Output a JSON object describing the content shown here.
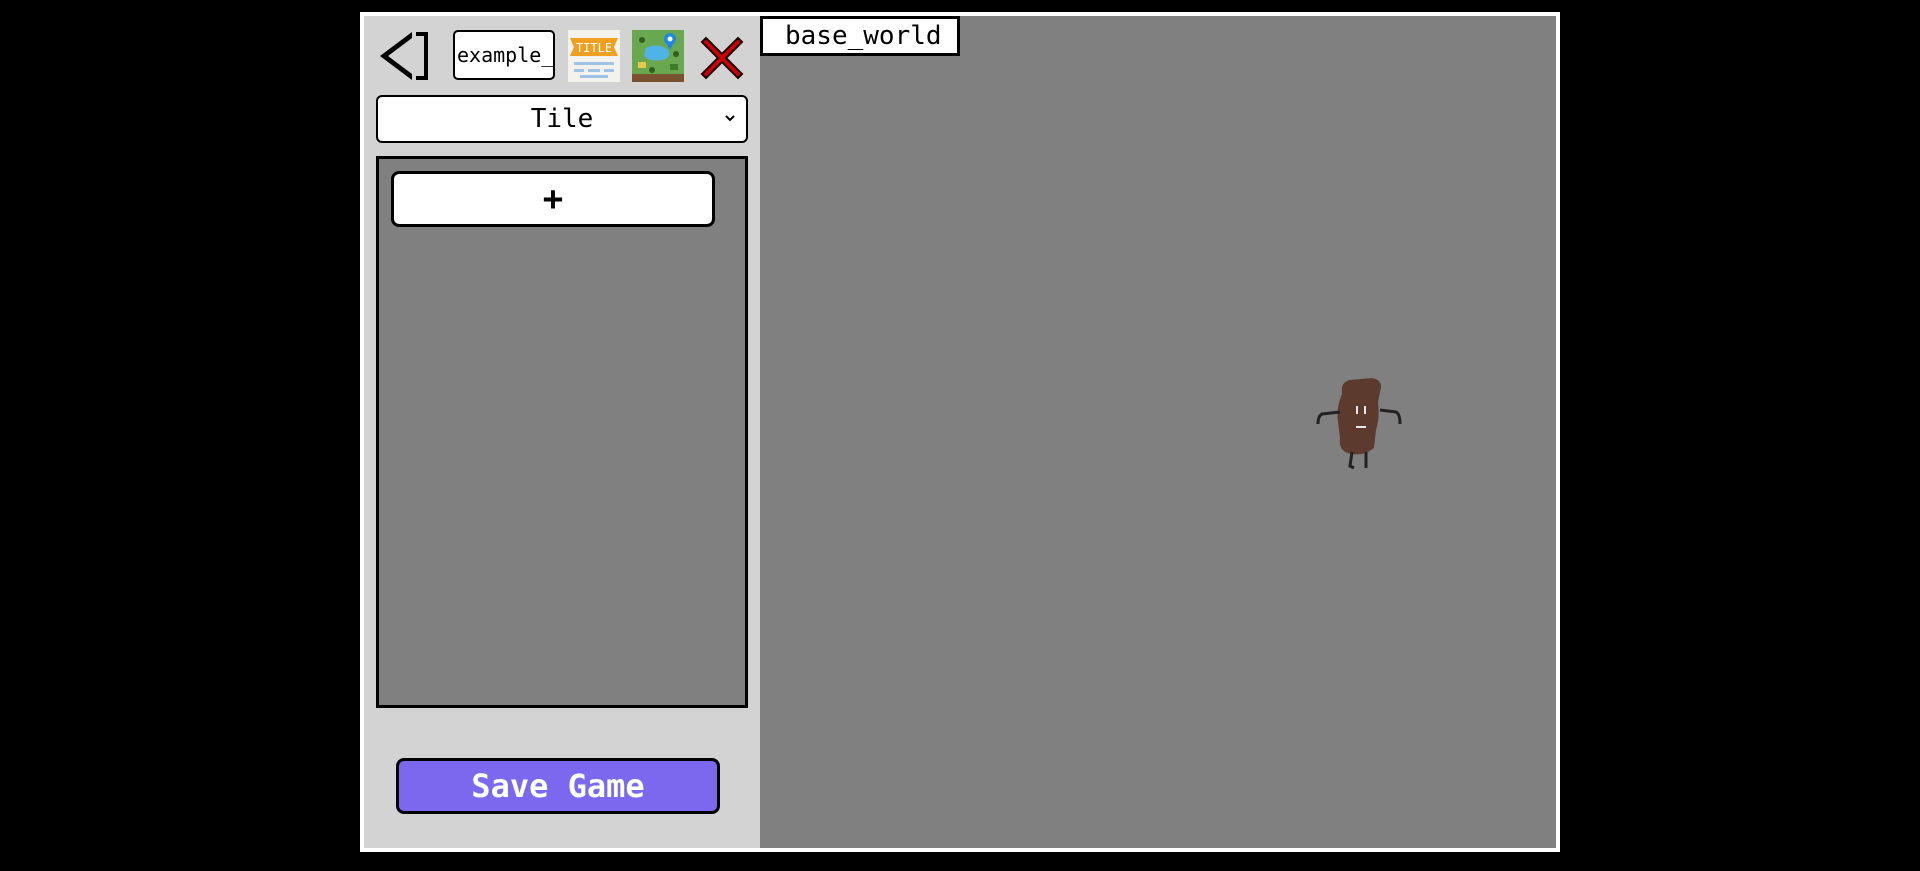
{
  "toolbar": {
    "game_name_value": "example_",
    "title_icon_text": "TITLE",
    "back_icon": "back-arrow-icon",
    "title_screen_icon": "title-screen-icon",
    "world_map_icon": "world-map-icon",
    "close_icon": "close-icon"
  },
  "object_type": {
    "selected": "Tile"
  },
  "asset_panel": {
    "add_label": "+"
  },
  "save_button": {
    "label": "Save Game"
  },
  "world": {
    "tab_label": "base_world"
  },
  "colors": {
    "background": "#000000",
    "editor_bg": "#d3d3d3",
    "canvas_bg": "#808080",
    "save_accent": "#7b68ee",
    "close_red": "#d10000",
    "character_brown": "#5c3a2e"
  }
}
